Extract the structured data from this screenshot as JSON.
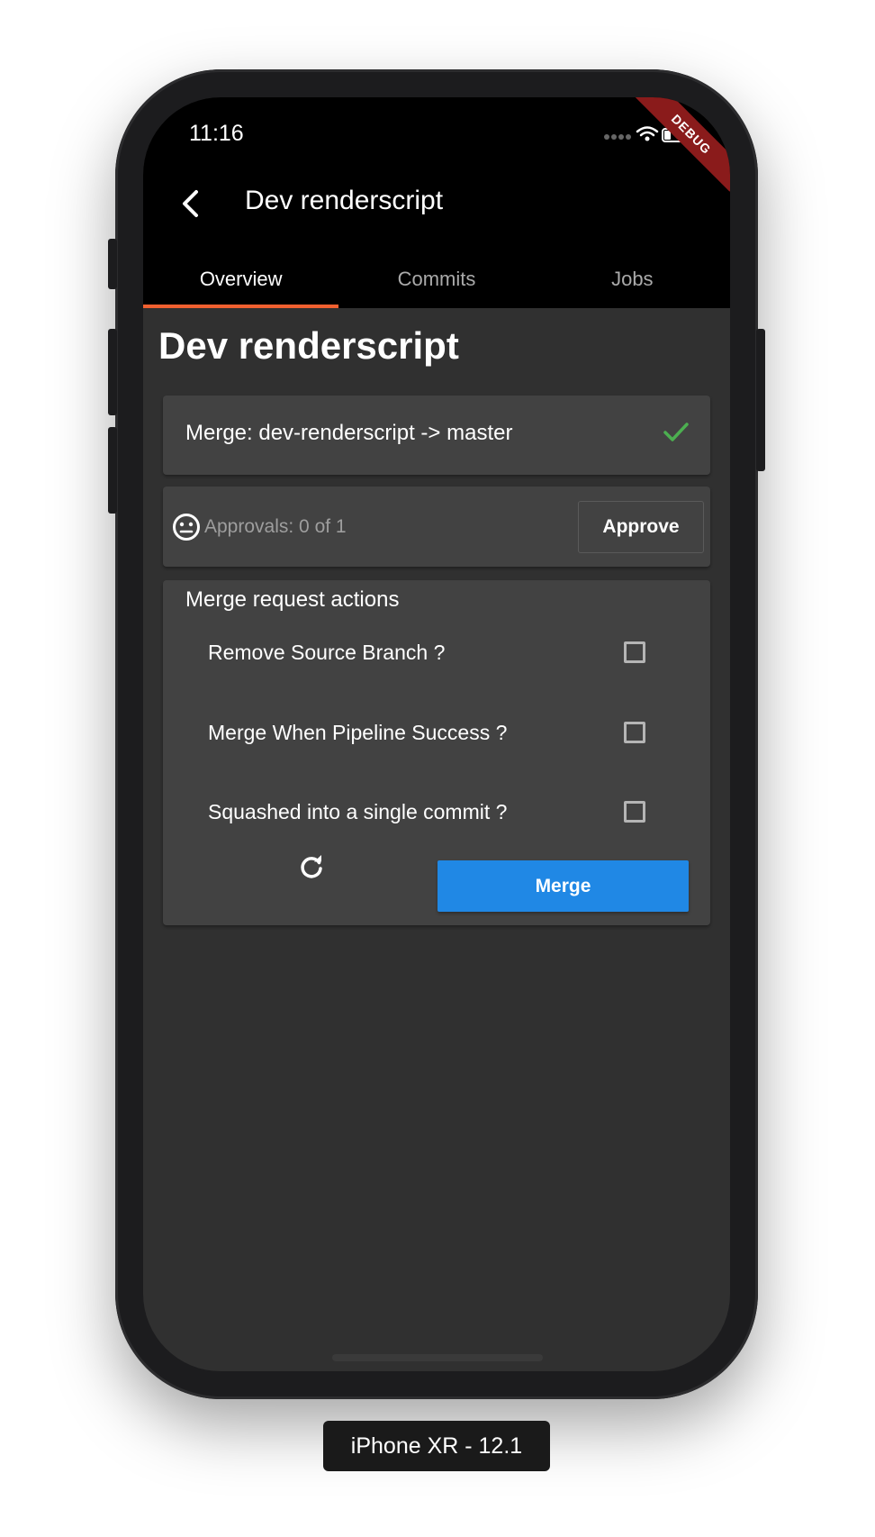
{
  "status_bar": {
    "time": "11:16",
    "debug": "DEBUG"
  },
  "app_bar": {
    "title": "Dev renderscript"
  },
  "tabs": [
    {
      "label": "Overview",
      "active": true
    },
    {
      "label": "Commits",
      "active": false
    },
    {
      "label": "Jobs",
      "active": false
    }
  ],
  "page_title": "Dev renderscript",
  "merge_card": {
    "label": "Merge: dev-renderscript -> master",
    "status_icon": "check-icon"
  },
  "approvals": {
    "label": "Approvals: 0 of 1",
    "button": "Approve",
    "icon": "neutral-face-icon"
  },
  "actions": {
    "title": "Merge request actions",
    "options": [
      {
        "label": "Remove Source Branch ?",
        "checked": false
      },
      {
        "label": "Merge When Pipeline Success ?",
        "checked": false
      },
      {
        "label": "Squashed into a single commit ?",
        "checked": false
      }
    ],
    "refresh_icon": "refresh-icon",
    "merge_button": "Merge"
  },
  "device_label": "iPhone XR - 12.1",
  "colors": {
    "accent_tab": "#f06030",
    "merge_button": "#2088e5",
    "success": "#4caf50"
  }
}
